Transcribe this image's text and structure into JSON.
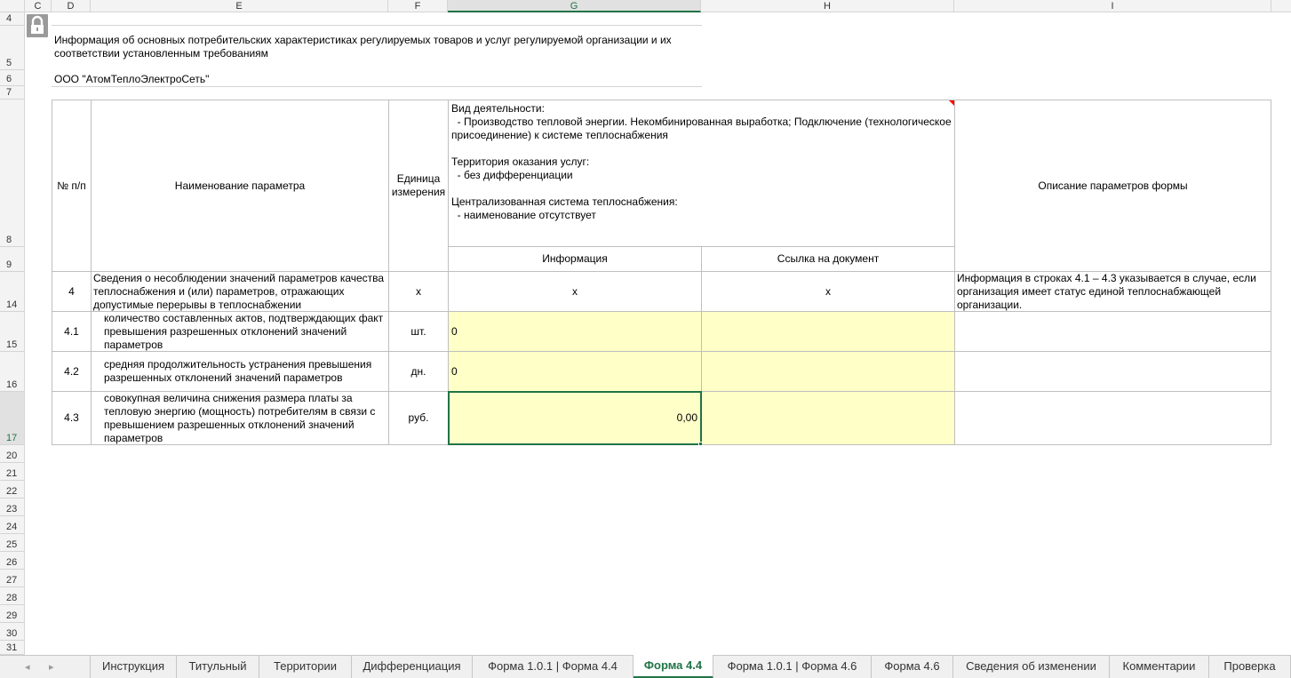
{
  "columns": [
    "C",
    "D",
    "E",
    "F",
    "G",
    "H",
    "I"
  ],
  "active_column": "G",
  "rows": [
    "4",
    "5",
    "6",
    "7",
    "8",
    "9",
    "14",
    "15",
    "16",
    "17",
    "20",
    "21",
    "22",
    "23",
    "24",
    "25",
    "26",
    "27",
    "28",
    "29",
    "30",
    "31"
  ],
  "active_row": "17",
  "title": "Информация об основных потребительских характеристиках регулируемых товаров и услуг регулируемой организации и их соответствии установленным требованиям",
  "org": "ООО \"АтомТеплоЭлектроСеть\"",
  "table": {
    "headers": {
      "num": "№ п/п",
      "name": "Наименование параметра",
      "unit": "Единица измерения",
      "activity": [
        "Вид деятельности:",
        "  - Производство тепловой энергии. Некомбинированная выработка; Подключение (технологическое присоединение) к системе теплоснабжения",
        "",
        "Территория оказания услуг:",
        "  - без дифференциации",
        "",
        "Централизованная система теплоснабжения:",
        "  - наименование отсутствует"
      ],
      "info": "Информация",
      "link": "Ссылка на документ",
      "desc": "Описание параметров формы"
    },
    "rows": [
      {
        "num": "4",
        "name": "Сведения о несоблюдении значений параметров качества теплоснабжения и (или) параметров, отражающих допустимые перерывы в теплоснабжении",
        "unit": "x",
        "info": "x",
        "link": "x",
        "desc": "Информация в строках 4.1 – 4.3 указывается в случае, если организация имеет статус единой теплоснабжающей организации."
      },
      {
        "num": "4.1",
        "name": "количество составленных актов, подтверждающих факт превышения разрешенных отклонений значений параметров",
        "unit": "шт.",
        "info": "0",
        "link": "",
        "desc": ""
      },
      {
        "num": "4.2",
        "name": "средняя продолжительность устранения превышения разрешенных отклонений значений параметров",
        "unit": "дн.",
        "info": "0",
        "link": "",
        "desc": ""
      },
      {
        "num": "4.3",
        "name": "совокупная величина снижения размера платы за тепловую энергию (мощность) потребителям в связи с превышением разрешенных отклонений значений параметров",
        "unit": "руб.",
        "info": "0,00",
        "link": "",
        "desc": ""
      }
    ]
  },
  "tabs": [
    "Инструкция",
    "Титульный",
    "Территории",
    "Дифференциация",
    "Форма 1.0.1 | Форма 4.4",
    "Форма 4.4",
    "Форма 1.0.1 | Форма 4.6",
    "Форма 4.6",
    "Сведения об изменении",
    "Комментарии",
    "Проверка"
  ],
  "active_tab": "Форма 4.4",
  "nav": {
    "prev": "◂",
    "next": "▸"
  },
  "colors": {
    "accent": "#217346",
    "input_fill": "#ffffc8",
    "comment_marker": "#ff0000"
  }
}
